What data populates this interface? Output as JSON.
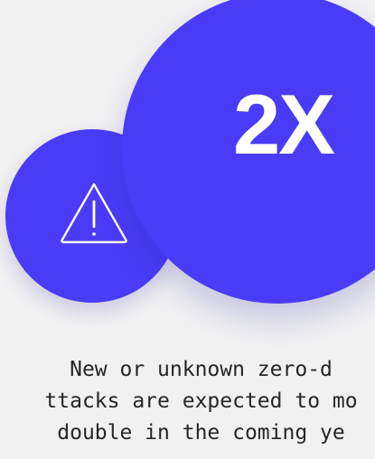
{
  "stat": {
    "value": "2X"
  },
  "caption": {
    "line1": "New or unknown zero-d",
    "line2": "ttacks are expected to mo",
    "line3": "double in the coming ye"
  },
  "icons": {
    "warning": "warning-triangle-icon"
  },
  "colors": {
    "accent": "#4a3cf6",
    "background": "#f1f1f2",
    "text": "#262626",
    "icon": "#ffffff"
  }
}
